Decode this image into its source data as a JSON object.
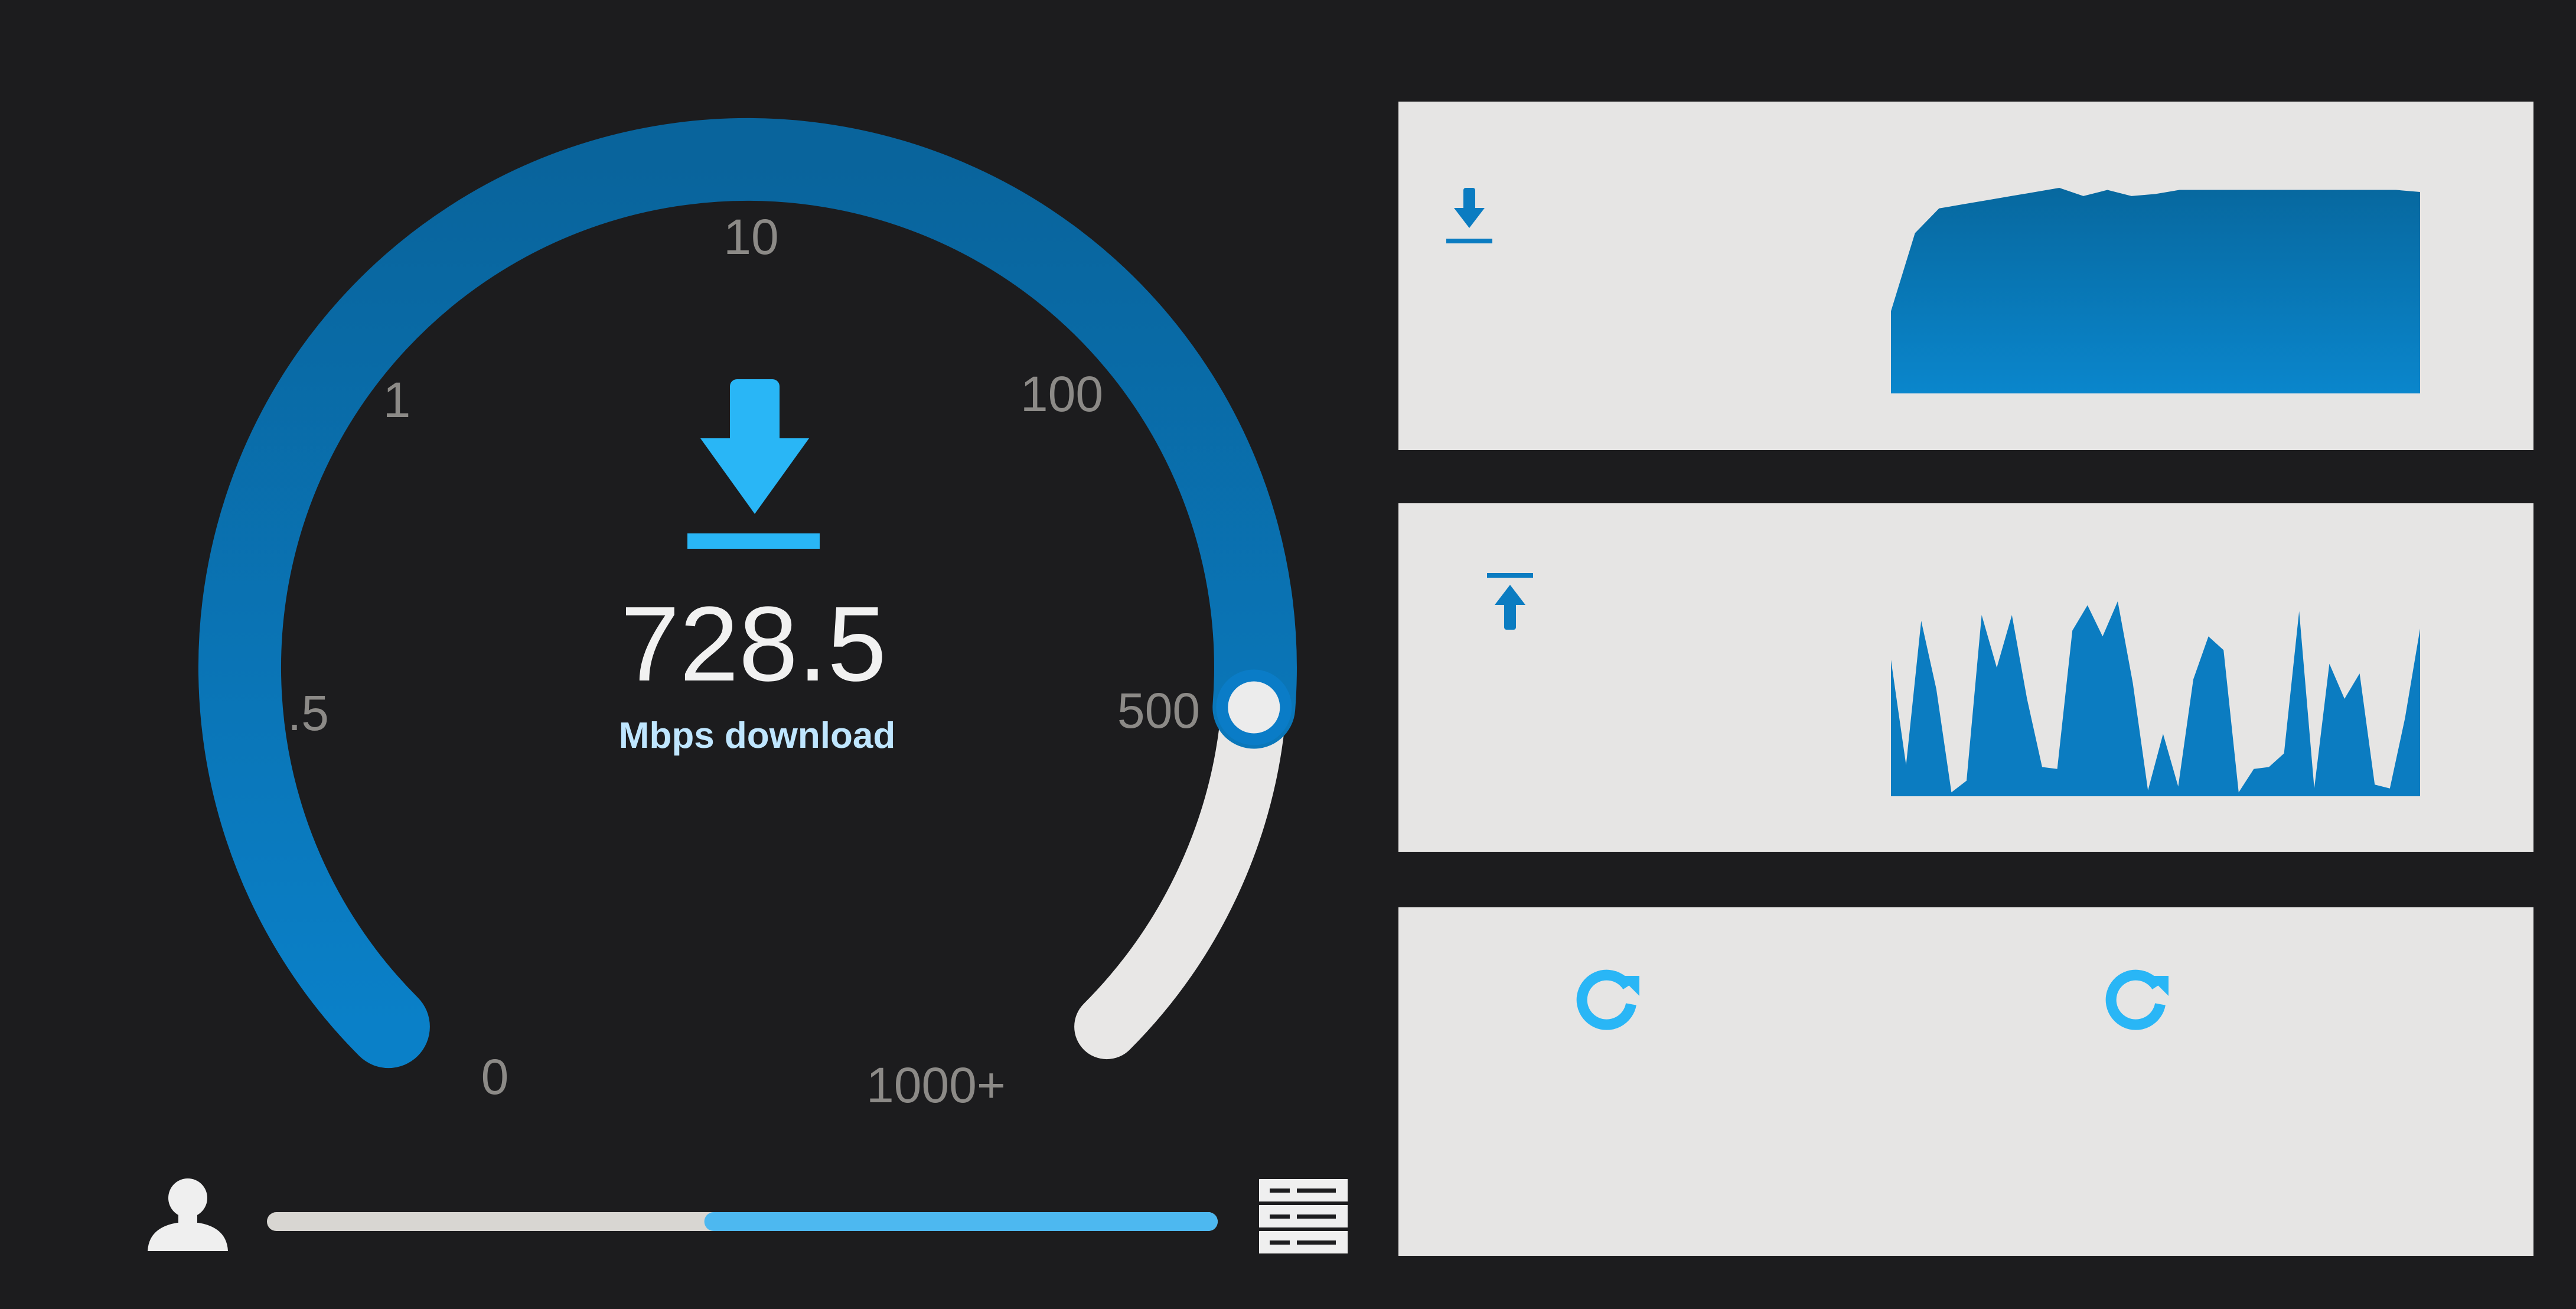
{
  "gauge": {
    "tick_labels": [
      "0",
      ".5",
      "1",
      "10",
      "100",
      "500",
      "1000+"
    ],
    "speed_value": "728.5",
    "speed_unit": "Mbps download",
    "needle_level_fraction": 0.85
  },
  "connection": {
    "client_icon": "user-icon",
    "server_icon": "server-icon",
    "progress_fraction": 0.46
  },
  "panels": {
    "download": {
      "icon": "download-icon",
      "chart_data": {
        "type": "area",
        "title": "",
        "xlabel": "",
        "ylabel": "",
        "ylim": [
          0,
          1
        ],
        "values": [
          0.4,
          0.78,
          0.9,
          0.92,
          0.94,
          0.96,
          0.98,
          1.0,
          0.96,
          0.99,
          0.96,
          0.97,
          0.99,
          0.99,
          0.99,
          0.99,
          0.99,
          0.99,
          0.99,
          0.99,
          0.99,
          0.99,
          0.98
        ]
      }
    },
    "upload": {
      "icon": "upload-icon",
      "chart_data": {
        "type": "area",
        "title": "",
        "xlabel": "",
        "ylabel": "",
        "ylim": [
          0,
          1
        ],
        "values": [
          0.7,
          0.16,
          0.9,
          0.55,
          0.02,
          0.08,
          0.93,
          0.66,
          0.93,
          0.5,
          0.15,
          0.14,
          0.85,
          0.98,
          0.82,
          1.0,
          0.58,
          0.03,
          0.32,
          0.05,
          0.6,
          0.82,
          0.75,
          0.02,
          0.14,
          0.15,
          0.22,
          0.95,
          0.04,
          0.68,
          0.5,
          0.63,
          0.06,
          0.04,
          0.4,
          0.86
        ]
      }
    },
    "third": {
      "left_icon": "refresh-icon",
      "right_icon": "refresh-icon"
    }
  },
  "colors": {
    "background": "#1c1c1e",
    "gauge_arc_dark": "#0a5f94",
    "gauge_arc_light": "#0a7cc7",
    "gauge_track": "#e8e7e6",
    "accent": "#29b6f6",
    "tick_label": "#8c8a87",
    "value_text": "#f1f1f1",
    "unit_text": "#bfe6ff",
    "panel": "#e6e5e4",
    "chart_fill": "#0b7cc1"
  }
}
